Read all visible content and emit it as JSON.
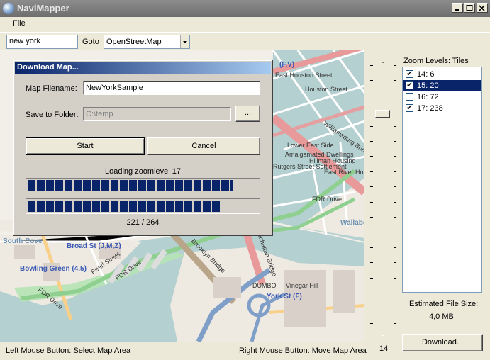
{
  "window": {
    "title": "NaviMapper"
  },
  "menu": {
    "file": "File"
  },
  "toolbar": {
    "search_value": "new york",
    "goto_label": "Goto",
    "map_source": "OpenStreetMap"
  },
  "map": {
    "labels": [
      "East Houston Street",
      "Houston Street",
      "(F,V)",
      "Williamsburg Bridge",
      "Lower East Side",
      "Amalgamated Dwellings",
      "Hillman Housing",
      "Rutgers Street Settlement",
      "East River Housing",
      "FDR Drive",
      "FDR Drive",
      "FDR Drive",
      "Broad St (J,M,Z)",
      "Bowling Green (4,5)",
      "Pearl Street",
      "Brooklyn Bridge",
      "Manhattan Bridge",
      "DUMBO",
      "Vinegar Hill",
      "York St (F)",
      "Wallabout Bay",
      "South Cove"
    ]
  },
  "status": {
    "left": "Left Mouse Button: Select Map Area",
    "right": "Right Mouse Button: Move Map Area"
  },
  "zoom": {
    "slider_value": "14",
    "slider_level": 14,
    "title": "Zoom Levels: Tiles",
    "levels": [
      {
        "label": "14: 6",
        "checked": true,
        "selected": false
      },
      {
        "label": "15: 20",
        "checked": true,
        "selected": true
      },
      {
        "label": "16: 72",
        "checked": false,
        "selected": false
      },
      {
        "label": "17: 238",
        "checked": true,
        "selected": false
      }
    ],
    "estimated_label": "Estimated File Size:",
    "estimated_value": "4,0 MB",
    "download_label": "Download..."
  },
  "dialog": {
    "title": "Download Map...",
    "filename_label": "Map Filename:",
    "filename_value": "NewYorkSample",
    "folder_label": "Save to Folder:",
    "folder_value": "C:\\temp",
    "browse_label": "...",
    "start_label": "Start",
    "cancel_label": "Cancel",
    "loading_text": "Loading zoomlevel 17",
    "progress_level_fraction": 0.89,
    "progress_total_fraction": 0.837,
    "count_text": "221 / 264"
  },
  "colors": {
    "selection": "#0a246a",
    "progress": "#0a246a",
    "title_gradient_end": "#a6caf0"
  }
}
